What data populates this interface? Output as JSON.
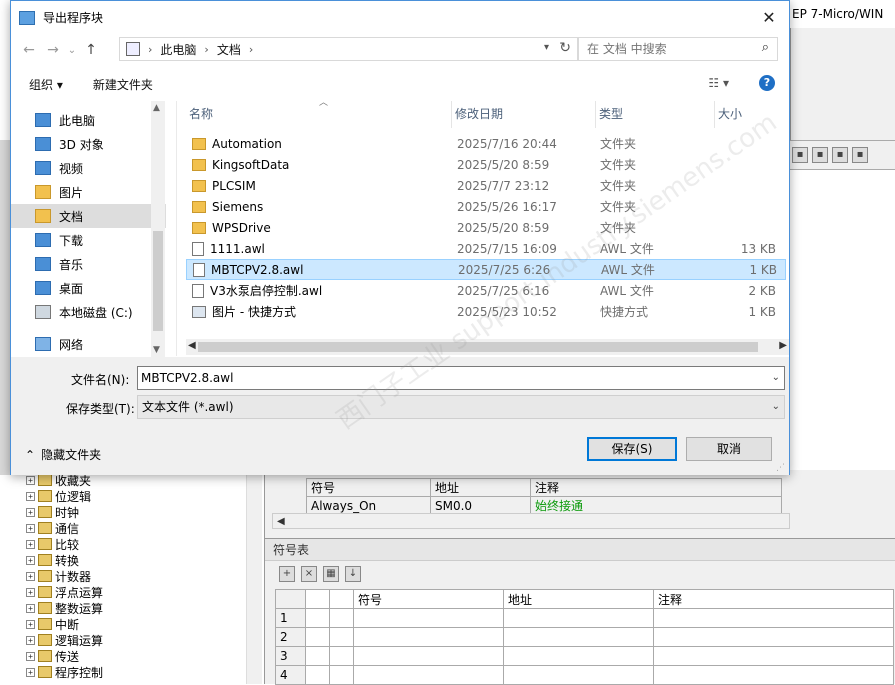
{
  "app": {
    "title": "EP 7-Micro/WIN",
    "tree": [
      "收藏夹",
      "位逻辑",
      "时钟",
      "通信",
      "比较",
      "转换",
      "计数器",
      "浮点运算",
      "整数运算",
      "中断",
      "逻辑运算",
      "传送",
      "程序控制"
    ],
    "var_table": {
      "headers": [
        "符号",
        "地址",
        "注释"
      ],
      "rows": [
        [
          "Always_On",
          "SM0.0",
          "始终接通"
        ]
      ]
    },
    "symbol_table": {
      "title": "符号表",
      "headers": [
        "符号",
        "地址",
        "注释"
      ],
      "row_numbers": [
        "1",
        "2",
        "3",
        "4"
      ]
    }
  },
  "dialog": {
    "title": "导出程序块",
    "close": "✕",
    "nav": {
      "back": "←",
      "forward": "→",
      "dropdown": "⌄",
      "up": "↑"
    },
    "address": {
      "crumbs": [
        "此电脑",
        "文档"
      ]
    },
    "search_placeholder": "在 文档 中搜索",
    "commands": {
      "organize": "组织 ▾",
      "new_folder": "新建文件夹"
    },
    "nav_pane": [
      {
        "label": "此电脑",
        "icon": "computer-icon"
      },
      {
        "label": "3D 对象",
        "icon": "cube-icon"
      },
      {
        "label": "视频",
        "icon": "video-icon"
      },
      {
        "label": "图片",
        "icon": "picture-icon"
      },
      {
        "label": "文档",
        "icon": "document-icon",
        "selected": true
      },
      {
        "label": "下载",
        "icon": "download-icon"
      },
      {
        "label": "音乐",
        "icon": "music-icon"
      },
      {
        "label": "桌面",
        "icon": "desktop-icon"
      },
      {
        "label": "本地磁盘 (C:)",
        "icon": "drive-icon"
      },
      {
        "label": "网络",
        "icon": "network-icon"
      }
    ],
    "columns": {
      "name": "名称",
      "date": "修改日期",
      "type": "类型",
      "size": "大小"
    },
    "files": [
      {
        "name": "Automation",
        "date": "2025/7/16 20:44",
        "type": "文件夹",
        "size": "",
        "icon": "folder-icon"
      },
      {
        "name": "KingsoftData",
        "date": "2025/5/20 8:59",
        "type": "文件夹",
        "size": "",
        "icon": "folder-icon"
      },
      {
        "name": "PLCSIM",
        "date": "2025/7/7 23:12",
        "type": "文件夹",
        "size": "",
        "icon": "folder-icon"
      },
      {
        "name": "Siemens",
        "date": "2025/5/26 16:17",
        "type": "文件夹",
        "size": "",
        "icon": "folder-icon"
      },
      {
        "name": "WPSDrive",
        "date": "2025/5/20 8:59",
        "type": "文件夹",
        "size": "",
        "icon": "folder-icon"
      },
      {
        "name": "1111.awl",
        "date": "2025/7/15 16:09",
        "type": "AWL 文件",
        "size": "13 KB",
        "icon": "awl-file-icon"
      },
      {
        "name": "MBTCPV2.8.awl",
        "date": "2025/7/25 6:26",
        "type": "AWL 文件",
        "size": "1 KB",
        "icon": "awl-file-icon",
        "selected": true
      },
      {
        "name": "V3水泵启停控制.awl",
        "date": "2025/7/25 6:16",
        "type": "AWL 文件",
        "size": "2 KB",
        "icon": "awl-file-icon"
      },
      {
        "name": "图片 - 快捷方式",
        "date": "2025/5/23 10:52",
        "type": "快捷方式",
        "size": "1 KB",
        "icon": "shortcut-icon"
      }
    ],
    "filename_label": "文件名(N):",
    "filename_value": "MBTCPV2.8.awl",
    "filetype_label": "保存类型(T):",
    "filetype_value": "文本文件 (*.awl)",
    "hide_folders": "隐藏文件夹",
    "save_button": "保存(S)",
    "cancel_button": "取消",
    "watermark": "西门子工业 support.industry.siemens.com"
  }
}
